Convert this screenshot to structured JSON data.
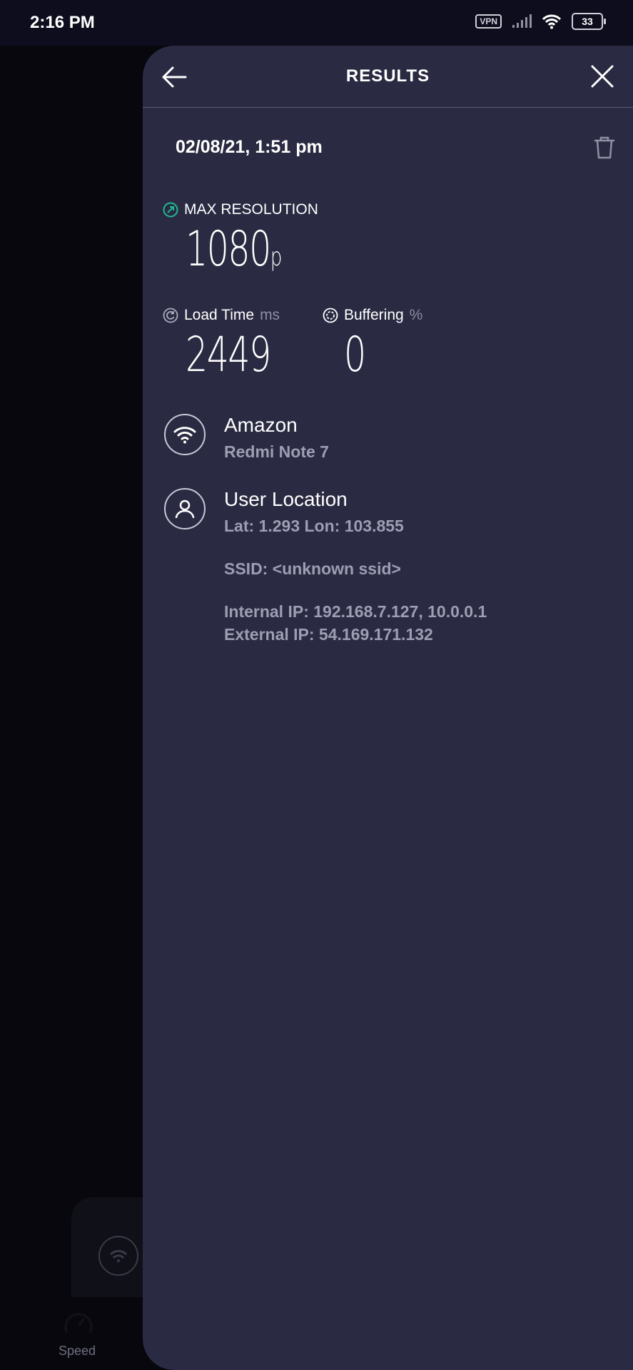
{
  "status_bar": {
    "time": "2:16 PM",
    "vpn": "VPN",
    "battery": "33"
  },
  "background": {
    "speed_label": "Speed"
  },
  "panel": {
    "title": "RESULTS",
    "date": "02/08/21, 1:51 pm",
    "max_resolution": {
      "label": "MAX RESOLUTION",
      "value": "1080",
      "suffix": "p"
    },
    "load_time": {
      "label": "Load Time",
      "unit": "ms",
      "value": "2449"
    },
    "buffering": {
      "label": "Buffering",
      "unit": "%",
      "value": "0"
    },
    "provider": {
      "name": "Amazon",
      "device": "Redmi Note 7"
    },
    "location": {
      "title": "User Location",
      "coords": "Lat: 1.293 Lon: 103.855",
      "ssid": "SSID: <unknown ssid>",
      "internal_ip": "Internal IP: 192.168.7.127, 10.0.0.1",
      "external_ip": "External IP: 54.169.171.132"
    }
  },
  "colors": {
    "panel_bg": "#2a2b42",
    "accent_green": "#1fb992",
    "muted_text": "#9d9eb3"
  }
}
